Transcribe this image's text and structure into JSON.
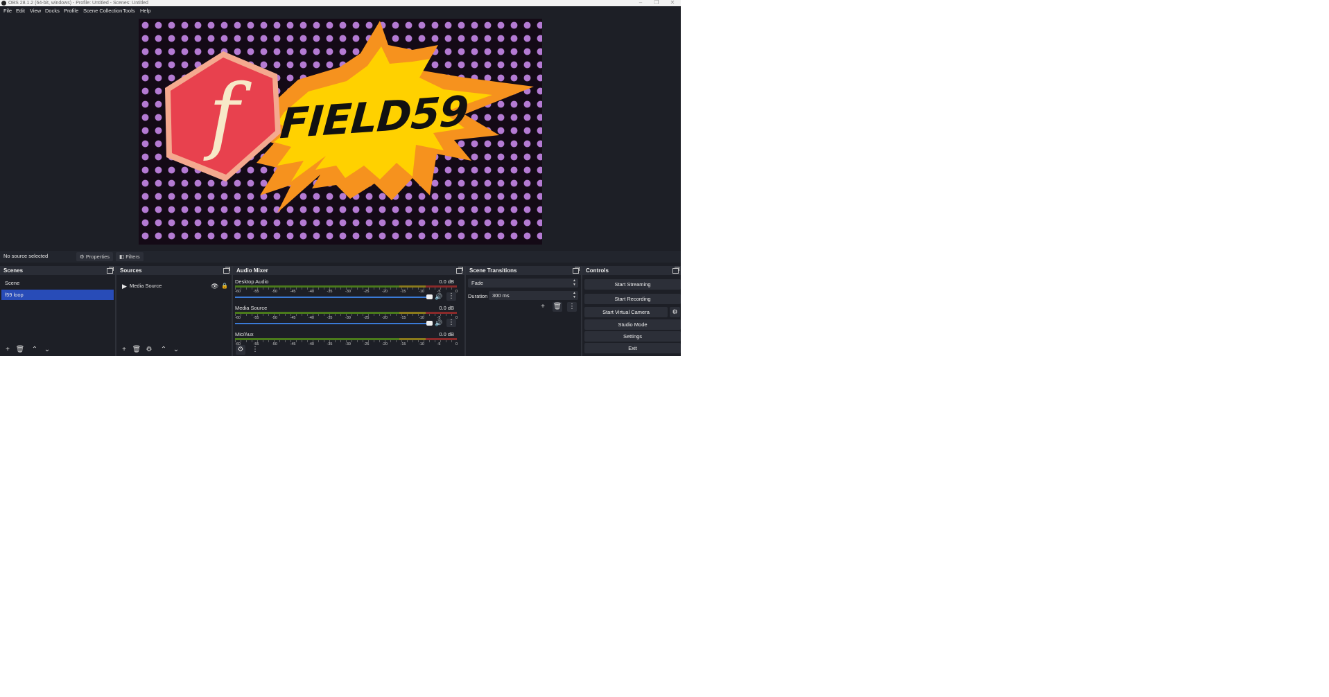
{
  "window": {
    "title": "OBS 28.1.2 (64-bit, windows) - Profile: Untitled - Scenes: Untitled",
    "min_icon": "minimize-icon",
    "max_icon": "maximize-icon",
    "close_icon": "close-icon"
  },
  "menu": [
    "File",
    "Edit",
    "View",
    "Docks",
    "Profile",
    "Scene Collection",
    "Tools",
    "Help"
  ],
  "preview": {
    "logo_letter": "f",
    "logo_text": "FIELD59",
    "colors": {
      "dots": "#b47ad3",
      "background": "#140a16",
      "burst_outer": "#f6921e",
      "burst_inner": "#ffd100",
      "hexagon": "#e8414e",
      "hexagon_border": "#f4a98f"
    }
  },
  "source_toolbar": {
    "status": "No source selected",
    "properties": "Properties",
    "filters": "Filters"
  },
  "scenes": {
    "title": "Scenes",
    "items": [
      {
        "label": "Scene",
        "selected": false
      },
      {
        "label": "f59 loop",
        "selected": true
      }
    ]
  },
  "sources": {
    "title": "Sources",
    "items": [
      {
        "label": "Media Source",
        "visible": true,
        "locked": false
      }
    ]
  },
  "audio_mixer": {
    "title": "Audio Mixer",
    "scale": [
      "-60",
      "-55",
      "-50",
      "-45",
      "-40",
      "-35",
      "-30",
      "-25",
      "-20",
      "-15",
      "-10",
      "-5",
      "0"
    ],
    "channels": [
      {
        "name": "Desktop Audio",
        "db": "0.0 dB",
        "volume_fraction": 1.0
      },
      {
        "name": "Media Source",
        "db": "0.0 dB",
        "volume_fraction": 1.0
      },
      {
        "name": "Mic/Aux",
        "db": "0.0 dB",
        "volume_fraction": 1.0
      }
    ]
  },
  "transitions": {
    "title": "Scene Transitions",
    "selected": "Fade",
    "duration_label": "Duration",
    "duration_value": "300 ms"
  },
  "controls": {
    "title": "Controls",
    "start_streaming": "Start Streaming",
    "start_recording": "Start Recording",
    "start_virtual_camera": "Start Virtual Camera",
    "studio_mode": "Studio Mode",
    "settings": "Settings",
    "exit": "Exit"
  }
}
